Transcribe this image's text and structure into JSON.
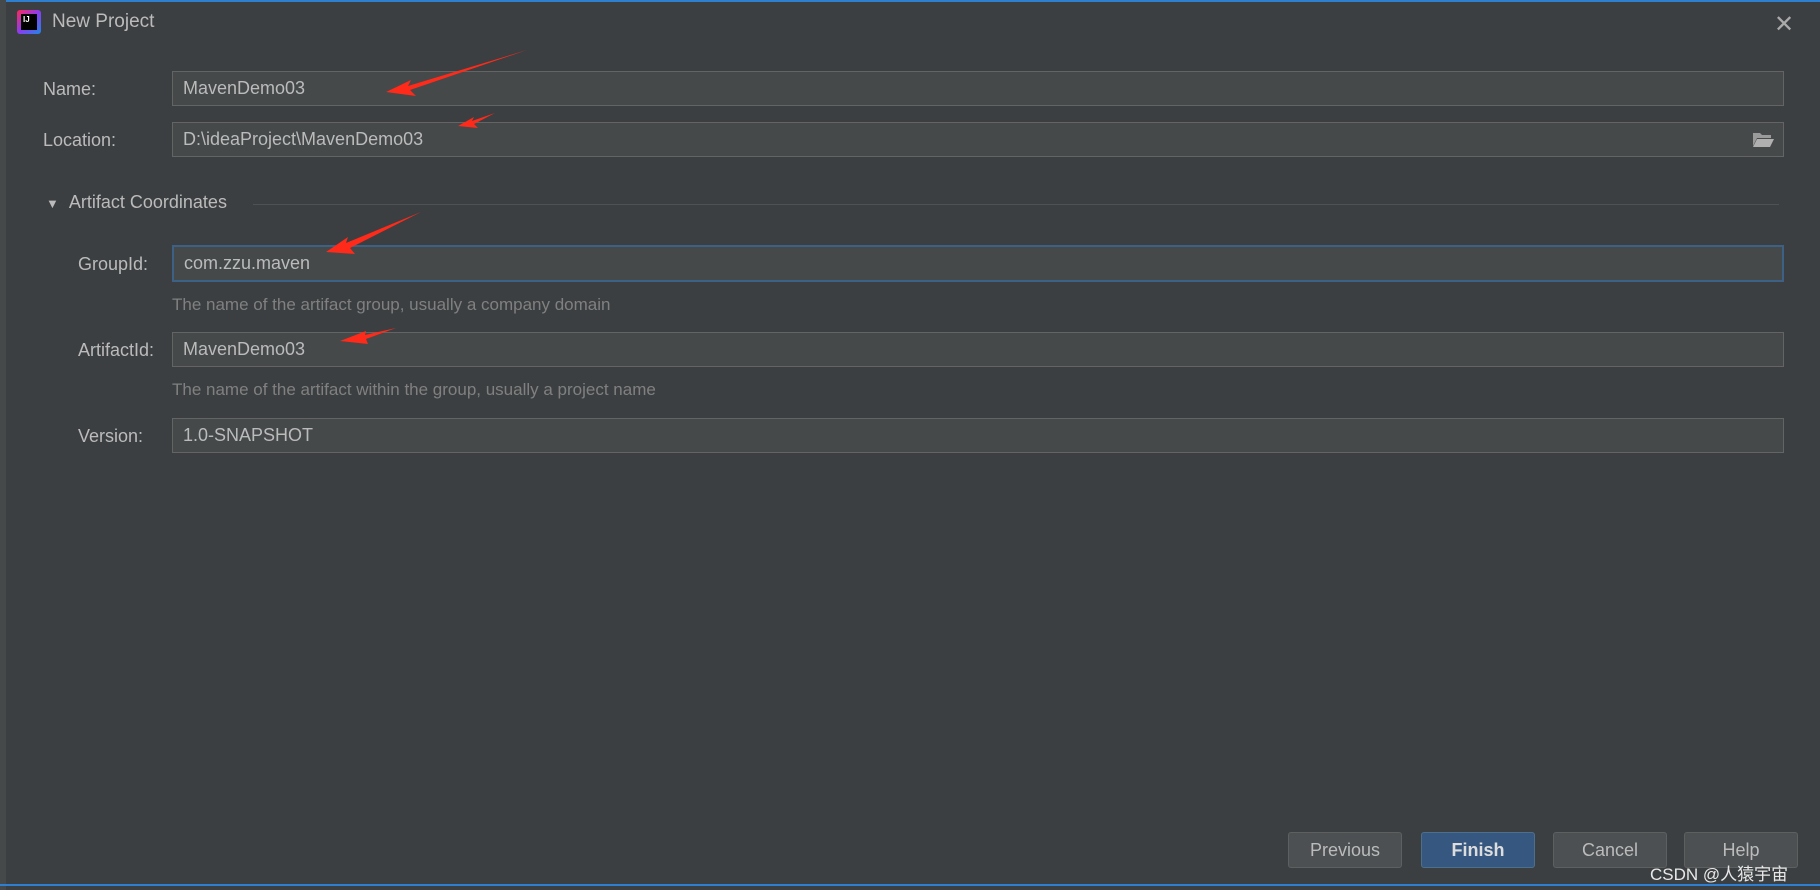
{
  "window": {
    "title": "New Project",
    "close_icon": "close-icon"
  },
  "form": {
    "name": {
      "label": "Name:",
      "value": "MavenDemo03"
    },
    "location": {
      "label": "Location:",
      "value": "D:\\ideaProject\\MavenDemo03"
    },
    "section": {
      "label": "Artifact Coordinates",
      "expanded": true
    },
    "group_id": {
      "label": "GroupId:",
      "value": "com.zzu.maven",
      "hint": "The name of the artifact group, usually a company domain"
    },
    "artifact_id": {
      "label": "ArtifactId:",
      "value": "MavenDemo03",
      "hint": "The name of the artifact within the group, usually a project name"
    },
    "version": {
      "label": "Version:",
      "value": "1.0-SNAPSHOT"
    }
  },
  "buttons": {
    "previous": "Previous",
    "finish": "Finish",
    "cancel": "Cancel",
    "help": "Help"
  },
  "watermark": "CSDN @人猿宇宙",
  "colors": {
    "accent": "#365880",
    "annotation": "#ff2a1a"
  }
}
